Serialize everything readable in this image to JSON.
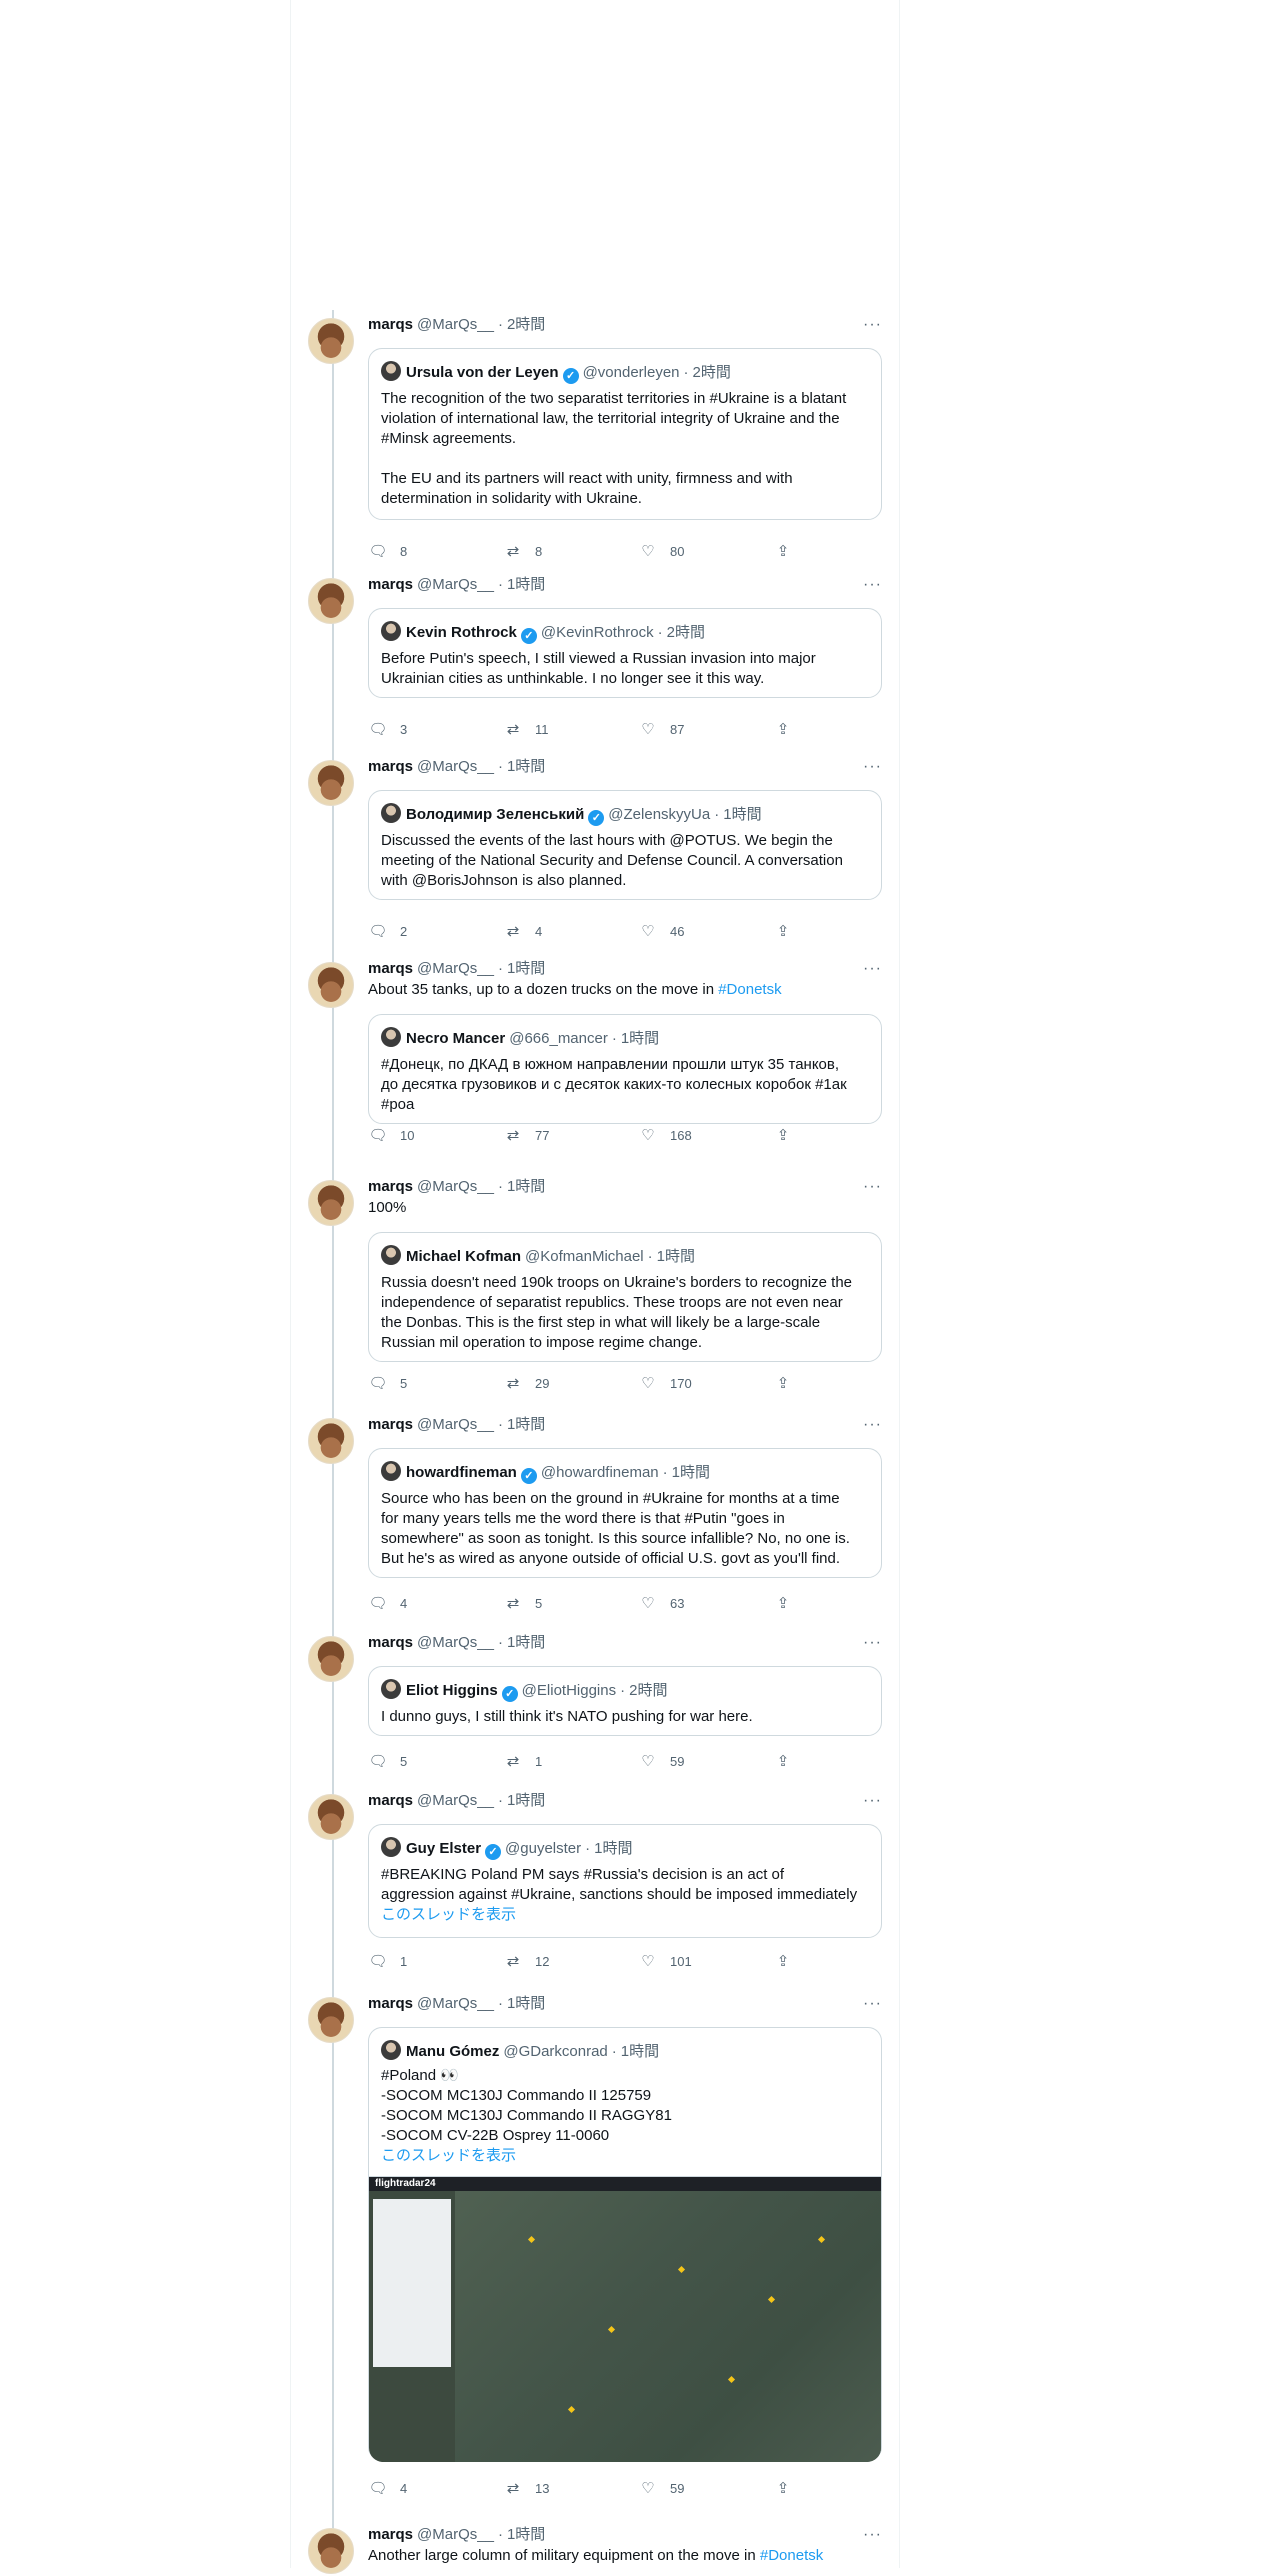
{
  "thread": [
    {
      "author": {
        "name": "marqs",
        "handle": "@MarQs__",
        "time": "2時間"
      },
      "text": "",
      "quote": {
        "name": "Ursula von der Leyen",
        "verified": true,
        "handle": "@vonderleyen",
        "time": "2時間",
        "text": "The recognition of the two separatist territories in #Ukraine is a blatant violation of international law, the territorial integrity of Ukraine and the #Minsk agreements.\n\nThe EU and its partners will react with unity, firmness and with determination in solidarity with Ukraine."
      },
      "stats": {
        "replies": "8",
        "retweets": "8",
        "likes": "80"
      }
    },
    {
      "author": {
        "name": "marqs",
        "handle": "@MarQs__",
        "time": "1時間"
      },
      "text": "",
      "quote": {
        "name": "Kevin Rothrock",
        "verified": true,
        "handle": "@KevinRothrock",
        "time": "2時間",
        "text": "Before Putin's speech, I still viewed a Russian invasion into major\nUkrainian cities as unthinkable. I no longer see it this way."
      },
      "stats": {
        "replies": "3",
        "retweets": "11",
        "likes": "87"
      }
    },
    {
      "author": {
        "name": "marqs",
        "handle": "@MarQs__",
        "time": "1時間"
      },
      "text": "",
      "quote": {
        "name": "Володимир Зеленський",
        "verified": true,
        "handle": "@ZelenskyyUa",
        "time": "1時間",
        "text": "Discussed the events of the last hours with @POTUS. We begin the\nmeeting of the National Security and Defense Council. A conversation\nwith @BorisJohnson is also planned."
      },
      "stats": {
        "replies": "2",
        "retweets": "4",
        "likes": "46"
      }
    },
    {
      "author": {
        "name": "marqs",
        "handle": "@MarQs__",
        "time": "1時間"
      },
      "text": "About 35 tanks, up to a dozen trucks on the move in ",
      "text_link": "#Donetsk",
      "quote": {
        "name": "Necro Mancer",
        "verified": false,
        "handle": "@666_mancer",
        "time": "1時間",
        "text": "#Донецк, по ДКАД в южном направлении прошли штук 35 танков,\nдо десятка грузовиков и с десяток каких-то колесных коробок #1ак\n#роа"
      },
      "stats": {
        "replies": "10",
        "retweets": "77",
        "likes": "168"
      }
    },
    {
      "author": {
        "name": "marqs",
        "handle": "@MarQs__",
        "time": "1時間"
      },
      "text": "100%",
      "quote": {
        "name": "Michael Kofman",
        "verified": false,
        "handle": "@KofmanMichael",
        "time": "1時間",
        "text": "Russia doesn't need 190k troops on Ukraine's borders to recognize the\nindependence of separatist republics. These troops are not even near\nthe Donbas. This is the first step in what will likely be a large-scale\nRussian mil operation to impose regime change."
      },
      "stats": {
        "replies": "5",
        "retweets": "29",
        "likes": "170"
      }
    },
    {
      "author": {
        "name": "marqs",
        "handle": "@MarQs__",
        "time": "1時間"
      },
      "text": "",
      "quote": {
        "name": "howardfineman",
        "verified": true,
        "handle": "@howardfineman",
        "time": "1時間",
        "text": "Source who has been on the ground in #Ukraine for months at a time\nfor many years tells me  the word there is that #Putin \"goes in\nsomewhere\" as soon as tonight. Is this source infallible? No, no one is.\nBut he's as wired as anyone outside of official U.S. govt as you'll find."
      },
      "stats": {
        "replies": "4",
        "retweets": "5",
        "likes": "63"
      }
    },
    {
      "author": {
        "name": "marqs",
        "handle": "@MarQs__",
        "time": "1時間"
      },
      "text": "",
      "quote": {
        "name": "Eliot Higgins",
        "verified": true,
        "handle": "@EliotHiggins",
        "time": "2時間",
        "text": "I dunno guys, I still think it's NATO pushing for war here."
      },
      "stats": {
        "replies": "5",
        "retweets": "1",
        "likes": "59"
      }
    },
    {
      "author": {
        "name": "marqs",
        "handle": "@MarQs__",
        "time": "1時間"
      },
      "text": "",
      "quote": {
        "name": "Guy Elster",
        "verified": true,
        "handle": "@guyelster",
        "time": "1時間",
        "text": "#BREAKING Poland PM says #Russia's decision is an act of\naggression against #Ukraine, sanctions should be imposed immediately",
        "show_thread": "このスレッドを表示"
      },
      "stats": {
        "replies": "1",
        "retweets": "12",
        "likes": "101"
      }
    },
    {
      "author": {
        "name": "marqs",
        "handle": "@MarQs__",
        "time": "1時間"
      },
      "text": "",
      "quote": {
        "name": "Manu Gómez",
        "verified": false,
        "handle": "@GDarkconrad",
        "time": "1時間",
        "text": "#Poland 👀\n-SOCOM MC130J Commando II 125759\n-SOCOM MC130J Commando II RAGGY81\n-SOCOM CV-22B Osprey 11-0060",
        "show_thread": "このスレッドを表示",
        "media_label": "flightradar24"
      },
      "stats": {
        "replies": "4",
        "retweets": "13",
        "likes": "59"
      }
    },
    {
      "author": {
        "name": "marqs",
        "handle": "@MarQs__",
        "time": "1時間"
      },
      "text": "Another large column of military equipment on the move in ",
      "text_link": "#Donetsk"
    }
  ],
  "ui": {
    "more": "···",
    "icons": [
      "reply-icon",
      "retweet-icon",
      "like-icon",
      "share-icon"
    ]
  }
}
